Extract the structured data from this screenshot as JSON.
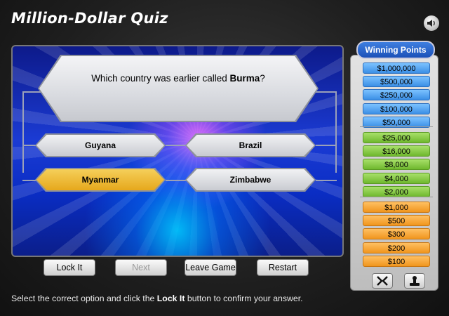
{
  "app_title": "Million-Dollar Quiz",
  "sound_icon": "speaker-icon",
  "question": {
    "prefix": "Which country was earlier called ",
    "highlight": "Burma",
    "suffix": "?"
  },
  "options": [
    {
      "label": "Guyana",
      "selected": false
    },
    {
      "label": "Brazil",
      "selected": false
    },
    {
      "label": "Myanmar",
      "selected": true
    },
    {
      "label": "Zimbabwe",
      "selected": false
    }
  ],
  "buttons": {
    "lock": "Lock It",
    "next": "Next",
    "leave": "Leave Game",
    "restart": "Restart"
  },
  "panel": {
    "heading": "Winning Points",
    "prizes": [
      "$1,000,000",
      "$500,000",
      "$250,000",
      "$100,000",
      "$50,000",
      "$25,000",
      "$16,000",
      "$8,000",
      "$4,000",
      "$2,000",
      "$1,000",
      "$500",
      "$300",
      "$200",
      "$100"
    ]
  },
  "lifelines": [
    "fifty-fifty-icon",
    "phone-a-friend-icon"
  ],
  "instruction": {
    "before": "Select the correct option and click the ",
    "bold": "Lock It",
    "after": " button to confirm your answer."
  },
  "colors": {
    "selected_option": "#e6a81c",
    "prize_blue": "#3b8fe6",
    "prize_green": "#6fb82e",
    "prize_orange": "#f0951e",
    "panel_heading": "#1b50b8"
  }
}
